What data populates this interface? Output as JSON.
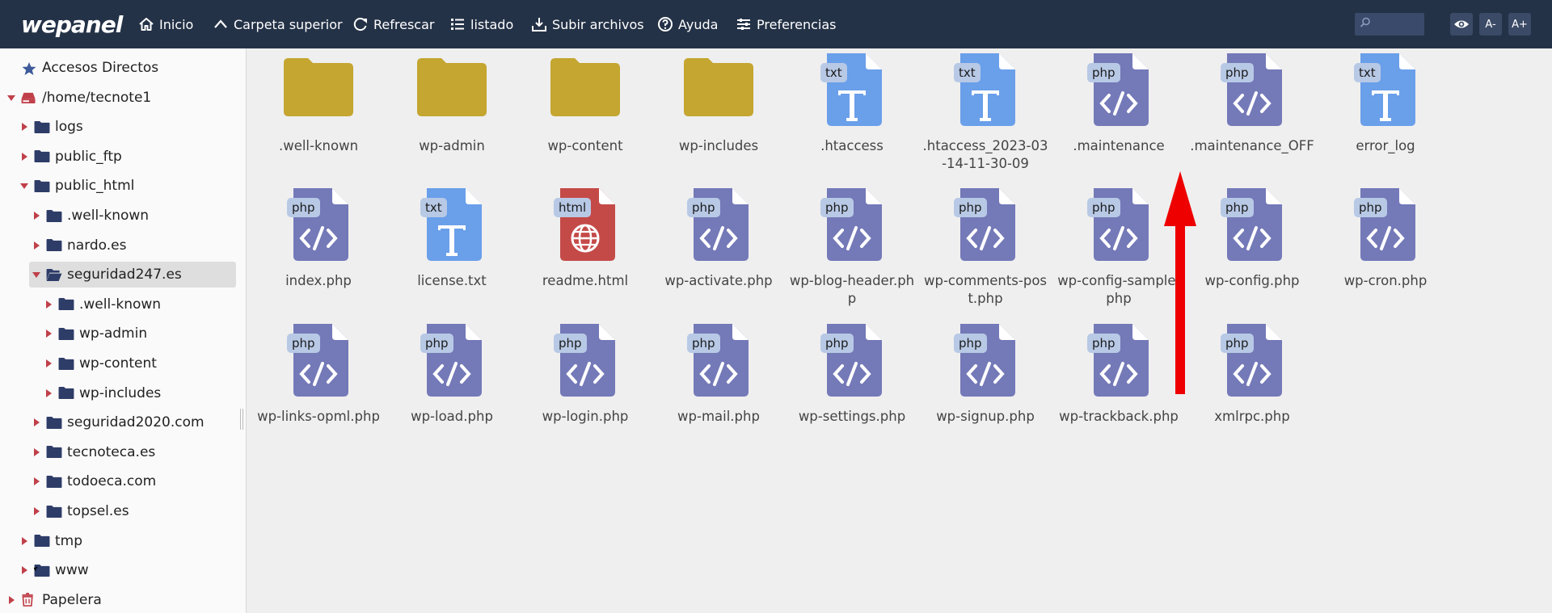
{
  "app": {
    "logo": "wepanel"
  },
  "nav": [
    {
      "label": "Inicio",
      "icon": "home-icon"
    },
    {
      "label": "Carpeta superior",
      "icon": "chevron-up-icon"
    },
    {
      "label": "Refrescar",
      "icon": "refresh-icon"
    },
    {
      "label": "listado",
      "icon": "list-icon"
    },
    {
      "label": "Subir archivos",
      "icon": "upload-icon"
    },
    {
      "label": "Ayuda",
      "icon": "help-icon"
    },
    {
      "label": "Preferencias",
      "icon": "sliders-icon"
    }
  ],
  "search": {
    "placeholder": "",
    "value": ""
  },
  "toolbar_right": {
    "view": "eye-icon",
    "font_decrease": "A-",
    "font_increase": "A+"
  },
  "sidebar": {
    "items": [
      {
        "label": "Accesos Directos",
        "icon": "star-icon",
        "level": 0,
        "caret": "none"
      },
      {
        "label": "/home/tecnote1",
        "icon": "drive-icon",
        "level": 0,
        "caret": "down"
      },
      {
        "label": "logs",
        "icon": "folder-icon",
        "level": 1,
        "caret": "right"
      },
      {
        "label": "public_ftp",
        "icon": "folder-icon",
        "level": 1,
        "caret": "right"
      },
      {
        "label": "public_html",
        "icon": "folder-icon",
        "level": 1,
        "caret": "down"
      },
      {
        "label": ".well-known",
        "icon": "folder-icon",
        "level": 2,
        "caret": "right"
      },
      {
        "label": "nardo.es",
        "icon": "folder-icon",
        "level": 2,
        "caret": "right"
      },
      {
        "label": "seguridad247.es",
        "icon": "folder-open-icon",
        "level": 2,
        "caret": "down",
        "selected": true
      },
      {
        "label": ".well-known",
        "icon": "folder-icon",
        "level": 3,
        "caret": "right"
      },
      {
        "label": "wp-admin",
        "icon": "folder-icon",
        "level": 3,
        "caret": "right"
      },
      {
        "label": "wp-content",
        "icon": "folder-icon",
        "level": 3,
        "caret": "right"
      },
      {
        "label": "wp-includes",
        "icon": "folder-icon",
        "level": 3,
        "caret": "right"
      },
      {
        "label": "seguridad2020.com",
        "icon": "folder-icon",
        "level": 2,
        "caret": "right"
      },
      {
        "label": "tecnoteca.es",
        "icon": "folder-icon",
        "level": 2,
        "caret": "right"
      },
      {
        "label": "todoeca.com",
        "icon": "folder-icon",
        "level": 2,
        "caret": "right"
      },
      {
        "label": "topsel.es",
        "icon": "folder-icon",
        "level": 2,
        "caret": "right"
      },
      {
        "label": "tmp",
        "icon": "folder-icon",
        "level": 1,
        "caret": "right"
      },
      {
        "label": "www",
        "icon": "folder-link-icon",
        "level": 1,
        "caret": "right"
      },
      {
        "label": "Papelera",
        "icon": "trash-icon",
        "level": 0,
        "caret": "right"
      }
    ]
  },
  "files": [
    {
      "name": ".well-known",
      "type": "folder"
    },
    {
      "name": "wp-admin",
      "type": "folder"
    },
    {
      "name": "wp-content",
      "type": "folder"
    },
    {
      "name": "wp-includes",
      "type": "folder"
    },
    {
      "name": ".htaccess",
      "type": "txt"
    },
    {
      "name": ".htaccess_2023-03-14-11-30-09",
      "type": "txt"
    },
    {
      "name": ".maintenance",
      "type": "php"
    },
    {
      "name": ".maintenance_OFF",
      "type": "php"
    },
    {
      "name": "error_log",
      "type": "txt"
    },
    {
      "name": "index.php",
      "type": "php"
    },
    {
      "name": "license.txt",
      "type": "txt"
    },
    {
      "name": "readme.html",
      "type": "html"
    },
    {
      "name": "wp-activate.php",
      "type": "php"
    },
    {
      "name": "wp-blog-header.php",
      "type": "php"
    },
    {
      "name": "wp-comments-post.php",
      "type": "php"
    },
    {
      "name": "wp-config-sample.php",
      "type": "php"
    },
    {
      "name": "wp-config.php",
      "type": "php"
    },
    {
      "name": "wp-cron.php",
      "type": "php"
    },
    {
      "name": "wp-links-opml.php",
      "type": "php"
    },
    {
      "name": "wp-load.php",
      "type": "php"
    },
    {
      "name": "wp-login.php",
      "type": "php"
    },
    {
      "name": "wp-mail.php",
      "type": "php"
    },
    {
      "name": "wp-settings.php",
      "type": "php"
    },
    {
      "name": "wp-signup.php",
      "type": "php"
    },
    {
      "name": "wp-trackback.php",
      "type": "php"
    },
    {
      "name": "xmlrpc.php",
      "type": "php"
    }
  ],
  "badges": {
    "txt": "txt",
    "php": "php",
    "html": "html"
  },
  "colors": {
    "topbar": "#243247",
    "folder": "#c4a630",
    "txt_file": "#6a9fea",
    "php_file": "#7479b8",
    "html_file": "#c44a48",
    "badge_bg": "#b8c9e6",
    "tree_folder": "#2e3c68",
    "tree_caret": "#c0404a",
    "arrow": "#ee0000"
  },
  "annotation": {
    "arrow": "red-up-arrow"
  }
}
